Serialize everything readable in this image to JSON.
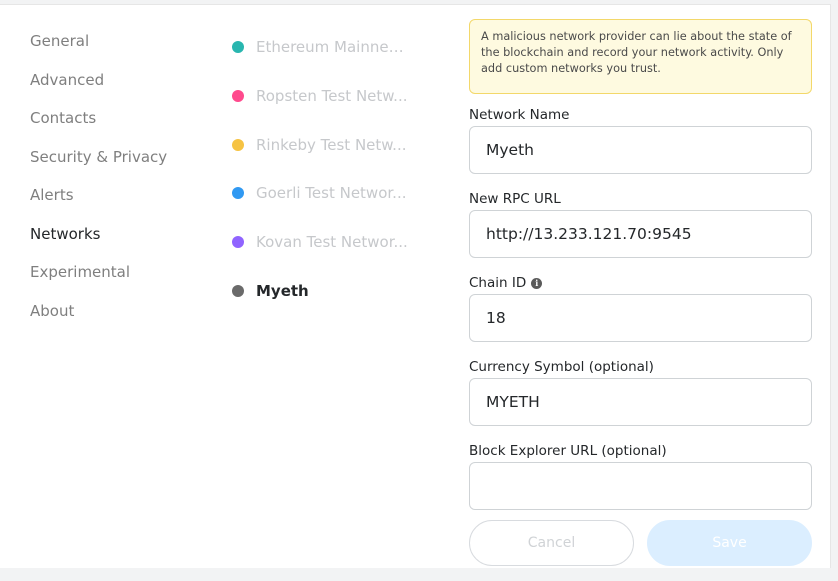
{
  "settings_menu": {
    "items": [
      {
        "label": "General",
        "active": false
      },
      {
        "label": "Advanced",
        "active": false
      },
      {
        "label": "Contacts",
        "active": false
      },
      {
        "label": "Security & Privacy",
        "active": false
      },
      {
        "label": "Alerts",
        "active": false
      },
      {
        "label": "Networks",
        "active": true
      },
      {
        "label": "Experimental",
        "active": false
      },
      {
        "label": "About",
        "active": false
      }
    ]
  },
  "networks": {
    "items": [
      {
        "label": "Ethereum Mainnet...",
        "color": "#29b6af",
        "selected": false
      },
      {
        "label": "Ropsten Test Netw...",
        "color": "#ff4a8d",
        "selected": false
      },
      {
        "label": "Rinkeby Test Netw...",
        "color": "#f6c343",
        "selected": false
      },
      {
        "label": "Goerli Test Networ...",
        "color": "#3099f2",
        "selected": false
      },
      {
        "label": "Kovan Test Networ...",
        "color": "#9064ff",
        "selected": false
      },
      {
        "label": "Myeth",
        "color": "#6a6a6a",
        "selected": true
      }
    ]
  },
  "form": {
    "warning": "A malicious network provider can lie about the state of the blockchain and record your network activity. Only add custom networks you trust.",
    "network_name": {
      "label": "Network Name",
      "value": "Myeth"
    },
    "rpc_url": {
      "label": "New RPC URL",
      "value": "http://13.233.121.70:9545"
    },
    "chain_id": {
      "label": "Chain ID",
      "value": "18",
      "info_icon": "info-icon"
    },
    "currency_symbol": {
      "label": "Currency Symbol (optional)",
      "value": "MYETH"
    },
    "block_explorer": {
      "label": "Block Explorer URL (optional)",
      "value": ""
    },
    "cancel_label": "Cancel",
    "save_label": "Save"
  }
}
